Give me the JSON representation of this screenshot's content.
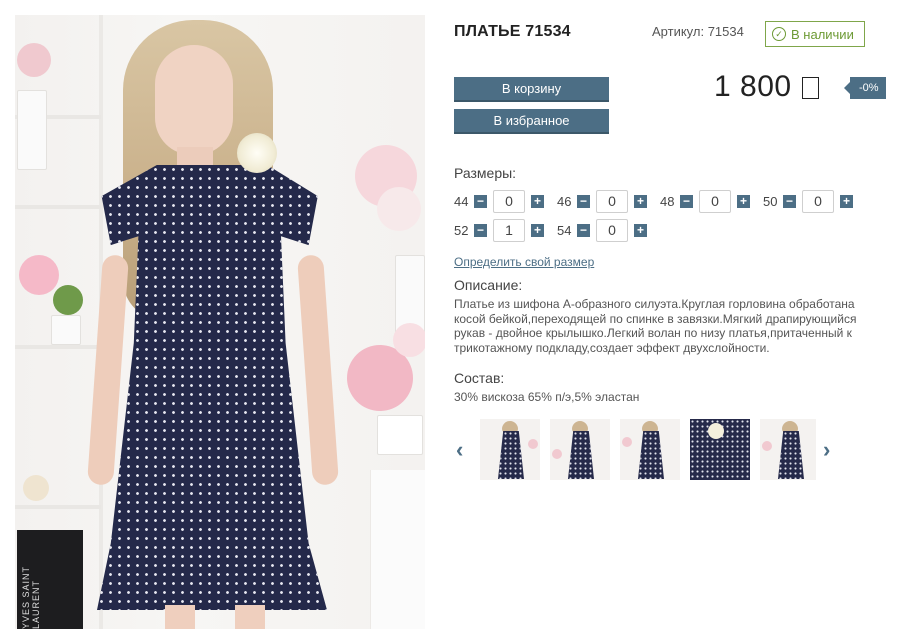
{
  "product": {
    "title": "ПЛАТЬЕ 71534",
    "article_label": "Артикул: 71534",
    "stock_label": "В наличии",
    "price": "1 800",
    "discount": "-0%"
  },
  "actions": {
    "cart_label": "В корзину",
    "favorite_label": "В избранное"
  },
  "sizes": {
    "label": "Размеры:",
    "items": [
      {
        "size": "44",
        "qty": "0"
      },
      {
        "size": "46",
        "qty": "0"
      },
      {
        "size": "48",
        "qty": "0"
      },
      {
        "size": "50",
        "qty": "0"
      },
      {
        "size": "52",
        "qty": "1"
      },
      {
        "size": "54",
        "qty": "0"
      }
    ],
    "minus_symbol": "−",
    "plus_symbol": "+",
    "find_size_link": "Определить свой размер"
  },
  "description": {
    "label": "Описание:",
    "text": "Платье из шифона А-образного силуэта.Круглая горловина обработана косой бейкой,переходящей по спинке в завязки.Мягкий драпирующийся рукав - двойное крылышко.Легкий волан по низу платья,притаченный к трикотажному подкладу,создает эффект двухслойности."
  },
  "composition": {
    "label": "Состав:",
    "text": "30% вискоза 65% п/э,5% эластан"
  },
  "gallery": {
    "prev_icon": "chevron-left-icon",
    "next_icon": "chevron-right-icon",
    "prev_glyph": "‹",
    "next_glyph": "›",
    "thumbnails": [
      "thumbnail-1",
      "thumbnail-2",
      "thumbnail-3",
      "thumbnail-4",
      "thumbnail-5"
    ]
  },
  "photo": {
    "book_text": "YVES SAINT LAURENT"
  },
  "colors": {
    "accent": "#4c6e85",
    "stock_green": "#6d9a35",
    "dress_navy": "#24294a"
  }
}
